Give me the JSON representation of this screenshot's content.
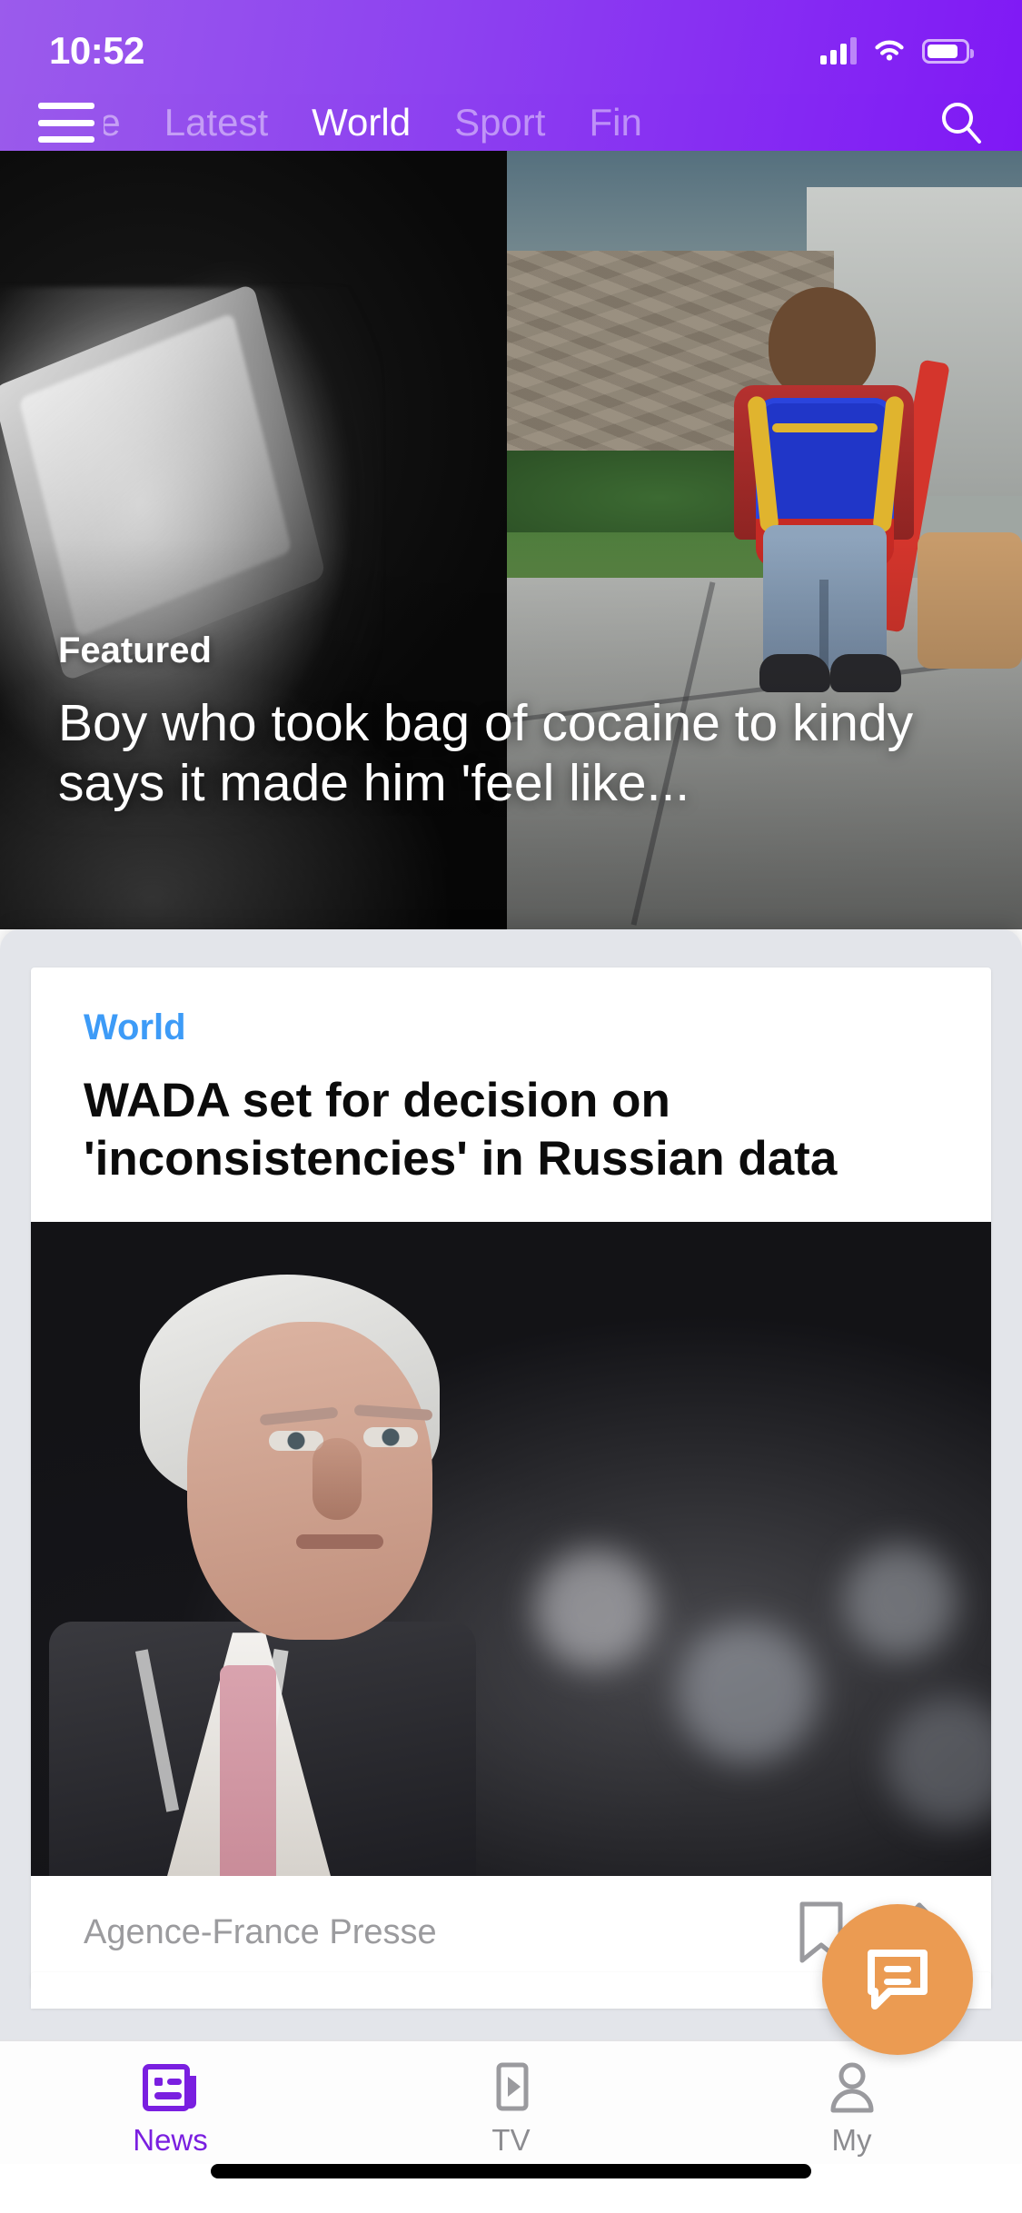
{
  "status_bar": {
    "time": "10:52",
    "signal_icon": "cellular-signal-icon",
    "wifi_icon": "wifi-icon",
    "battery_icon": "battery-icon",
    "battery_level_pct": 72
  },
  "top_nav": {
    "menu_icon": "hamburger-menu-icon",
    "search_icon": "search-icon",
    "tabs": [
      {
        "label": "ne",
        "active": false,
        "clipped": true
      },
      {
        "label": "Latest",
        "active": false,
        "clipped": false
      },
      {
        "label": "World",
        "active": true,
        "clipped": false
      },
      {
        "label": "Sport",
        "active": false,
        "clipped": false
      },
      {
        "label": "Fin",
        "active": false,
        "clipped": true
      }
    ]
  },
  "hero": {
    "kicker": "Featured",
    "headline": "Boy who took bag of cocaine to kindy says it made him 'feel like...",
    "image_alt_left": "bag-of-white-powder-photo",
    "image_alt_right": "child-with-blue-backpack-walking-photo"
  },
  "article_card": {
    "category": "World",
    "category_color": "#3d9bf7",
    "headline": "WADA set for decision on 'inconsistencies' in Russian data",
    "image_alt": "man-in-suit-with-pink-tie-photo",
    "source": "Agence-France Presse",
    "bookmark_icon": "bookmark-icon",
    "share_icon": "share-icon"
  },
  "fab": {
    "icon": "chat-bubble-icon",
    "color": "#eb9b52"
  },
  "bottom_nav": {
    "active_color": "#7a1fe0",
    "inactive_color": "#8c8c90",
    "items": [
      {
        "label": "News",
        "icon": "newspaper-icon",
        "active": true
      },
      {
        "label": "TV",
        "icon": "tv-play-icon",
        "active": false
      },
      {
        "label": "My",
        "icon": "person-icon",
        "active": false
      }
    ]
  },
  "theme": {
    "header_gradient_start": "#9b5bec",
    "header_gradient_end": "#8019f5",
    "sheet_background": "#e3e5ea",
    "card_background": "#ffffff"
  }
}
